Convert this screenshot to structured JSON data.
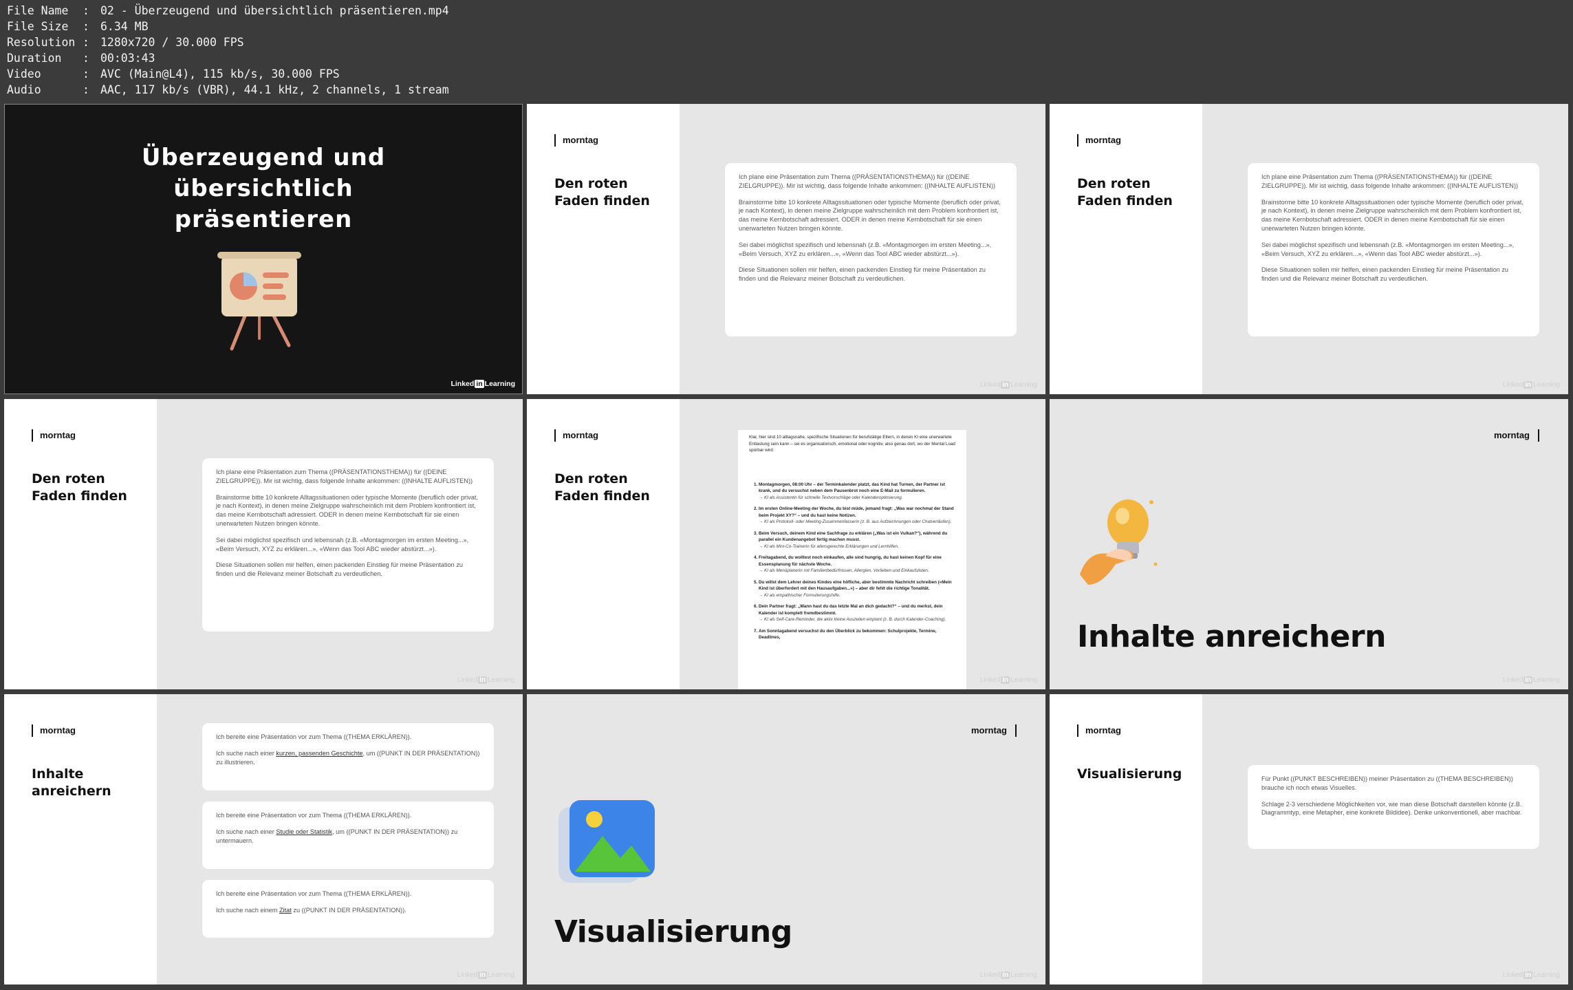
{
  "meta": [
    {
      "key": "File Name",
      "value": "02 - Überzeugend und übersichtlich präsentieren.mp4"
    },
    {
      "key": "File Size",
      "value": "6.34 MB"
    },
    {
      "key": "Resolution",
      "value": "1280x720 / 30.000 FPS"
    },
    {
      "key": "Duration",
      "value": "00:03:43"
    },
    {
      "key": "Video",
      "value": "AVC (Main@L4), 115 kb/s, 30.000 FPS"
    },
    {
      "key": "Audio",
      "value": "AAC, 117 kb/s (VBR), 44.1 kHz, 2 channels, 1 stream"
    }
  ],
  "brand": "morntag",
  "watermark": {
    "pre": "Linked",
    "in": "in",
    "post": "Learning"
  },
  "title_slide": {
    "title": "Überzeugend und übersichtlich präsentieren"
  },
  "slide_title_faden": "Den roten Faden finden",
  "prompt_faden": {
    "p1": "Ich plane eine Präsentation zum Thema ((PRÄSENTATIONSTHEMA)) für ((DEINE ZIELGRUPPE)). Mir ist wichtig, dass folgende Inhalte ankommen: ((INHALTE AUFLISTEN))",
    "p2": "Brainstorme bitte 10 konkrete Alltagssituationen oder typische Momente (beruflich oder privat, je nach Kontext), in denen meine Zielgruppe wahrscheinlich mit dem Problem konfrontiert ist, das meine Kernbotschaft adressiert. ODER in denen meine Kernbotschaft für sie einen unerwarteten Nutzen bringen könnte.",
    "p3": "Sei dabei möglichst spezifisch und lebensnah (z.B. «Montagmorgen im ersten Meeting...», «Beim Versuch, XYZ zu erklären...», «Wenn das Tool ABC wieder abstürzt...»).",
    "p4": "Diese Situationen sollen mir helfen, einen packenden Einstieg für meine Präsentation zu finden und die Relevanz meiner Botschaft zu verdeutlichen."
  },
  "answer_doc": {
    "intro": "Klar, hier sind 10 alltagsnahe, spezifische Situationen für berufstätige Eltern, in denen KI eine unerwartete Entlastung sein kann – sei es organisatorisch, emotional oder kognitiv, also genau dort, wo der Mental Load spürbar wird:",
    "items": [
      {
        "n": "Montagmorgen, 08:00 Uhr – der Terminkalender platzt, das Kind hat Turnen, der Partner ist krank, und du versuchst neben dem Pausenbrot noch eine E-Mail zu formulieren.",
        "s": "→ KI als Assistentin für schnelle Textvorschläge oder Kalenderoptimierung."
      },
      {
        "n": "Im ersten Online-Meeting der Woche, du bist müde, jemand fragt: „Was war nochmal der Stand beim Projekt XY?“ – und du hast keine Notizen.",
        "s": "→ KI als Protokoll- oder Meeting-Zusammenfasserin (z. B. aus Aufzeichnungen oder Chatverläufen)."
      },
      {
        "n": "Beim Versuch, deinem Kind eine Sachfrage zu erklären („Was ist ein Vulkan?“), während du parallel ein Kundenangebot fertig machen musst.",
        "s": "→ KI als Mini-Co-Trainerin für altersgerechte Erklärungen und Lernhilfen."
      },
      {
        "n": "Freitagabend, du wolltest noch einkaufen, alle sind hungrig, du hast keinen Kopf für eine Essensplanung für nächste Woche.",
        "s": "→ KI als Menüplanerin mit Familienbedürfnissen, Allergien, Vorlieben und Einkaufslisten."
      },
      {
        "n": "Du willst dem Lehrer deines Kindes eine höfliche, aber bestimmte Nachricht schreiben («Mein Kind ist überfordert mit den Hausaufgaben...») – aber dir fehlt die richtige Tonalität.",
        "s": "→ KI als empathischer Formulierungshilfe."
      },
      {
        "n": "Dein Partner fragt: „Wann hast du das letzte Mal an dich gedacht?“ – und du merkst, dein Kalender ist komplett fremdbestimmt.",
        "s": "→ KI als Self-Care-Reminder, die aktiv kleine Auszeiten einplant (z. B. durch Kalender-Coaching)."
      },
      {
        "n": "Am Sonntagabend versuchst du den Überblick zu bekommen: Schulprojekte, Termine, Deadlines,",
        "s": ""
      }
    ]
  },
  "section_inhalte": "Inhalte anreichern",
  "prompts_inhalte": [
    {
      "a": "Ich bereite eine Präsentation vor zum Thema ((THEMA ERKLÄREN)).",
      "b1": "Ich suche nach einer ",
      "u": "kurzen, passenden Geschichte",
      "b2": ", um ((PUNKT IN DER PRÄSENTATION)) zu illustrieren."
    },
    {
      "a": "Ich bereite eine Präsentation vor zum Thema ((THEMA ERKLÄREN)).",
      "b1": "Ich suche nach einer ",
      "u": "Studie oder Statistik",
      "b2": ", um ((PUNKT IN DER PRÄSENTATION)) zu untermauern."
    },
    {
      "a": "Ich bereite eine Präsentation vor zum Thema ((THEMA ERKLÄREN)).",
      "b1": "Ich suche nach einem ",
      "u": "Zitat",
      "b2": " zu ((PUNKT IN DER PRÄSENTATION))."
    }
  ],
  "section_visual": "Visualisierung",
  "prompt_visual": {
    "p1": "Für Punkt ((PUNKT BESCHREIBEN)) meiner Präsentation zu ((THEMA BESCHREIBEN)) brauche ich noch etwas Visuelles.",
    "p2": "Schlage 2-3 verschiedene Möglichkeiten vor, wie man diese Botschaft darstellen könnte (z.B. Diagrammtyp, eine Metapher, eine konkrete Bildidee). Denke unkonventionell, aber machbar."
  },
  "colors": {
    "header_bg": "#3b3b3b",
    "slide_bg": "#e6e6e6",
    "dark_slide": "#151515"
  }
}
